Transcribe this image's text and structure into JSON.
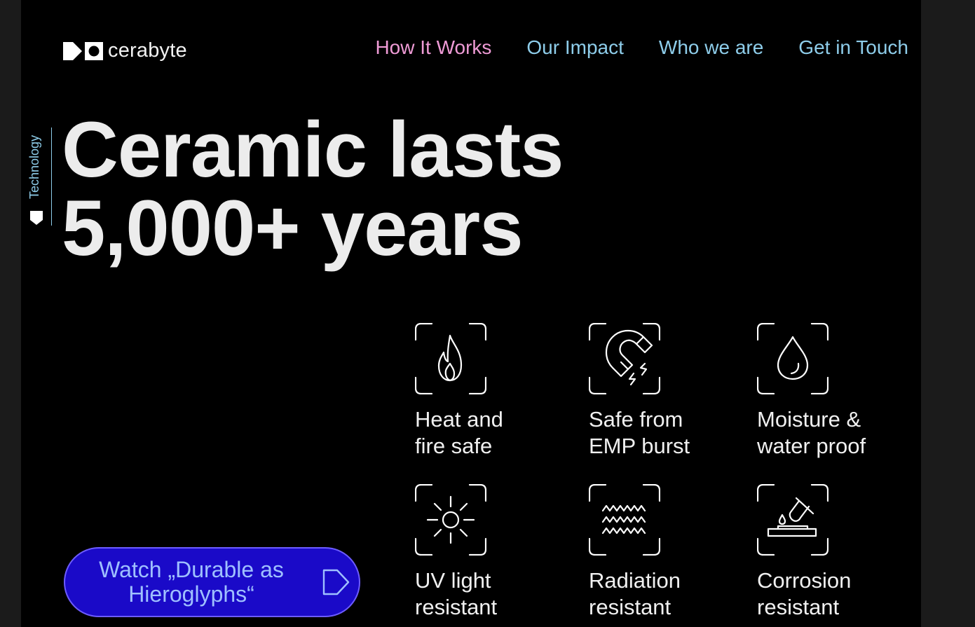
{
  "brand": {
    "name": "cerabyte"
  },
  "nav": {
    "items": [
      {
        "label": "How It Works",
        "active": true
      },
      {
        "label": "Our Impact",
        "active": false
      },
      {
        "label": "Who we are",
        "active": false
      },
      {
        "label": "Get in Touch",
        "active": false
      }
    ]
  },
  "side_label": "Technology",
  "hero": {
    "line1": "Ceramic lasts",
    "line2": "5,000+ years"
  },
  "features": [
    {
      "icon": "flame-icon",
      "line1": "Heat and",
      "line2": "fire safe"
    },
    {
      "icon": "magnet-icon",
      "line1": "Safe from",
      "line2": "EMP burst"
    },
    {
      "icon": "water-drop-icon",
      "line1": "Moisture &",
      "line2": "water proof"
    },
    {
      "icon": "sun-icon",
      "line1": "UV light",
      "line2": "resistant"
    },
    {
      "icon": "radiation-waves-icon",
      "line1": "Radiation",
      "line2": "resistant"
    },
    {
      "icon": "corrosion-icon",
      "line1": "Corrosion",
      "line2": "resistant"
    }
  ],
  "watch_button": {
    "line1": "Watch „Durable as",
    "line2": "Hieroglyphs“"
  },
  "colors": {
    "background": "#000000",
    "nav_active": "#ef9bd6",
    "nav_link": "#8ecdea",
    "button_bg": "#1a0ac8",
    "button_text": "#9fc0ff"
  }
}
